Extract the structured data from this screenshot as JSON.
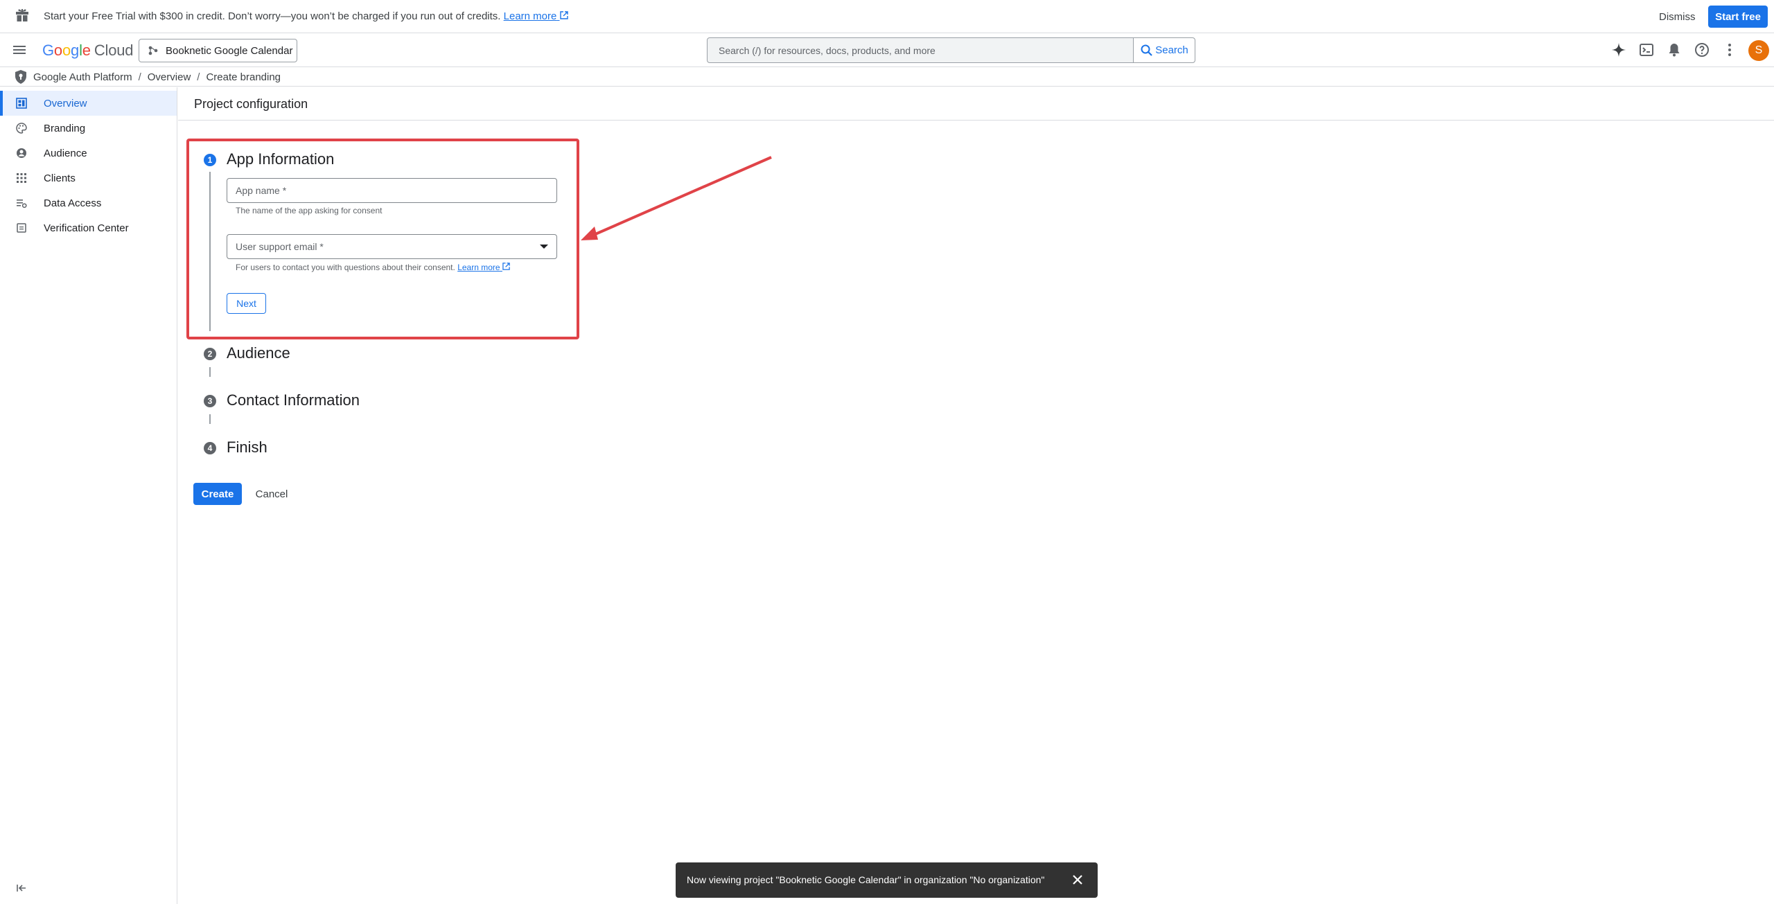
{
  "banner": {
    "message": "Start your Free Trial with $300 in credit. Don’t worry—you won’t be charged if you run out of credits.",
    "learn_more": "Learn more",
    "dismiss": "Dismiss",
    "start_free": "Start free"
  },
  "appbar": {
    "logo_google": "Google",
    "logo_cloud": "Cloud",
    "project_name": "Booknetic Google Calendar",
    "search_placeholder": "Search (/) for resources, docs, products, and more",
    "search_button": "Search",
    "avatar_initial": "S"
  },
  "breadcrumb": {
    "items": [
      "Google Auth Platform",
      "Overview",
      "Create branding"
    ],
    "separator": "/"
  },
  "sidebar": {
    "items": [
      {
        "label": "Overview",
        "icon": "dashboard-icon",
        "active": true
      },
      {
        "label": "Branding",
        "icon": "palette-icon"
      },
      {
        "label": "Audience",
        "icon": "account-circle-icon"
      },
      {
        "label": "Clients",
        "icon": "apps-grid-icon"
      },
      {
        "label": "Data Access",
        "icon": "data-access-icon"
      },
      {
        "label": "Verification Center",
        "icon": "verification-icon"
      }
    ]
  },
  "main": {
    "page_title": "Project configuration",
    "steps": [
      {
        "number": "1",
        "title": "App Information"
      },
      {
        "number": "2",
        "title": "Audience"
      },
      {
        "number": "3",
        "title": "Contact Information"
      },
      {
        "number": "4",
        "title": "Finish"
      }
    ],
    "app_name_label": "App name *",
    "app_name_hint": "The name of the app asking for consent",
    "support_email_label": "User support email *",
    "support_email_hint": "For users to contact you with questions about their consent.",
    "support_email_learn_more": "Learn more",
    "next_button": "Next",
    "create_button": "Create",
    "cancel_button": "Cancel"
  },
  "snackbar": {
    "message": "Now viewing project \"Booknetic Google Calendar\" in organization \"No organization\""
  },
  "colors": {
    "accent": "#1a73e8",
    "highlight": "#e04348",
    "avatar": "#e8710a"
  }
}
